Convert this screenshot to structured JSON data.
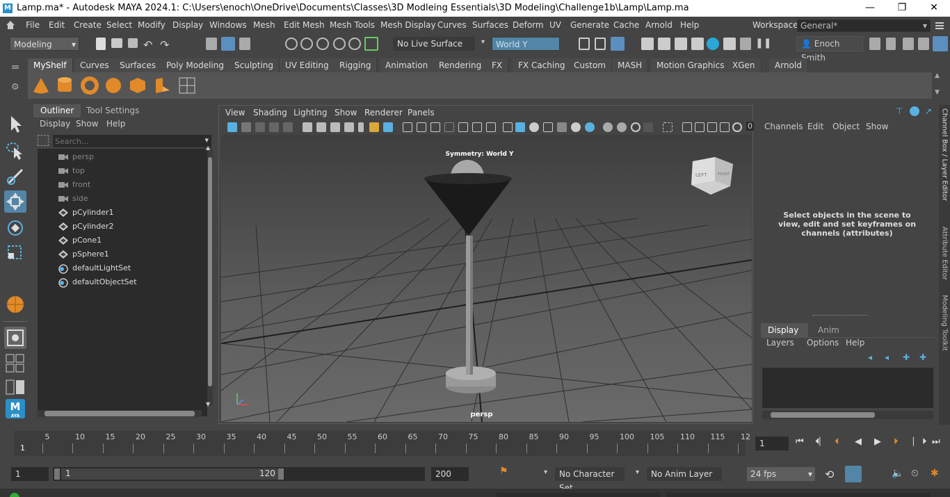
{
  "title_bar": {
    "icon": "M",
    "title": "Lamp.ma* - Autodesk MAYA 2024.1: C:\\Users\\enoch\\OneDrive\\Documents\\Classes\\3D Modleing Essentials\\3D Modeling\\Challenge1b\\Lamp\\Lamp.ma",
    "minimize": "—",
    "restore": "❐",
    "close": "✕"
  },
  "menu": {
    "items": [
      "File",
      "Edit",
      "Create",
      "Select",
      "Modify",
      "Display",
      "Windows",
      "Mesh",
      "Edit Mesh",
      "Mesh Tools",
      "Mesh Display",
      "Curves",
      "Surfaces",
      "Deform",
      "UV",
      "Generate",
      "Cache",
      "Arnold",
      "Help"
    ],
    "workspace_label": "Workspace:",
    "workspace_value": "General*"
  },
  "status_line": {
    "mode": "Modeling",
    "live_surface": "No Live Surface",
    "symmetry": "World Y",
    "user": "Enoch Smith"
  },
  "shelf": {
    "tabs": [
      "MyShelf",
      "Curves",
      "Surfaces",
      "Poly Modeling",
      "Sculpting",
      "UV Editing",
      "Rigging",
      "Animation",
      "Rendering",
      "FX",
      "FX Caching",
      "Custom",
      "MASH",
      "Motion Graphics",
      "XGen",
      "Arnold"
    ],
    "active_tab": "MyShelf"
  },
  "outliner": {
    "tabs": [
      "Outliner",
      "Tool Settings"
    ],
    "menu": [
      "Display",
      "Show",
      "Help"
    ],
    "search_placeholder": "Search...",
    "items": [
      {
        "name": "persp",
        "type": "camera",
        "dim": true
      },
      {
        "name": "top",
        "type": "camera",
        "dim": true
      },
      {
        "name": "front",
        "type": "camera",
        "dim": true
      },
      {
        "name": "side",
        "type": "camera",
        "dim": true
      },
      {
        "name": "pCylinder1",
        "type": "mesh",
        "dim": false
      },
      {
        "name": "pCylinder2",
        "type": "mesh",
        "dim": false
      },
      {
        "name": "pCone1",
        "type": "mesh",
        "dim": false
      },
      {
        "name": "pSphere1",
        "type": "mesh",
        "dim": false
      },
      {
        "name": "defaultLightSet",
        "type": "set",
        "dim": false
      },
      {
        "name": "defaultObjectSet",
        "type": "set",
        "dim": false
      }
    ]
  },
  "viewport": {
    "menu": [
      "View",
      "Shading",
      "Lighting",
      "Show",
      "Renderer",
      "Panels"
    ],
    "symmetry_label": "Symmetry: World Y",
    "camera_label": "persp",
    "viewcube_left": "LEFT",
    "viewcube_front": "FRONT",
    "toolbar_value": "0"
  },
  "channel_box": {
    "menu": [
      "Channels",
      "Edit",
      "Object",
      "Show"
    ],
    "message": "Select objects in the scene to view, edit and set keyframes on channels (attributes)"
  },
  "layer_editor": {
    "tabs": [
      "Display",
      "Anim"
    ],
    "menu": [
      "Layers",
      "Options",
      "Help"
    ]
  },
  "side_tabs": [
    "Channel Box / Layer Editor",
    "Attribute Editor",
    "Modeling Toolkit"
  ],
  "timeline": {
    "ticks": [
      "5",
      "10",
      "15",
      "20",
      "25",
      "30",
      "35",
      "40",
      "45",
      "50",
      "55",
      "60",
      "65",
      "70",
      "75",
      "80",
      "85",
      "90",
      "95",
      "100",
      "105",
      "110",
      "115",
      "12"
    ],
    "current_frame_marker": "1",
    "current_frame": "1"
  },
  "range": {
    "start": "1",
    "range_start": "1",
    "range_end": "120",
    "end": "200",
    "character_set": "No Character Set",
    "anim_layer": "No Anim Layer",
    "fps": "24 fps"
  }
}
